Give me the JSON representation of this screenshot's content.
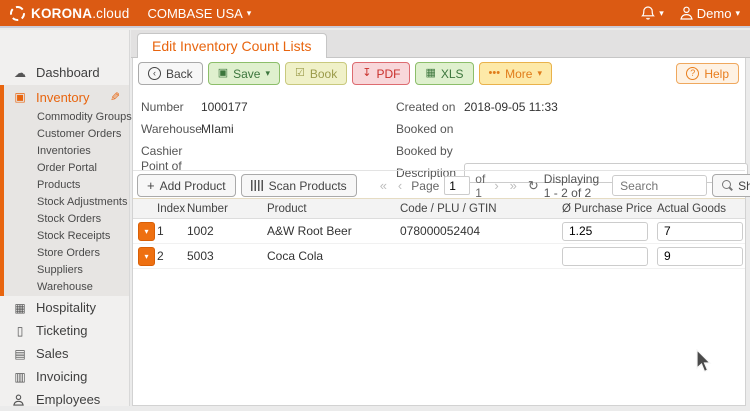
{
  "colors": {
    "brand_orange": "#E8650F",
    "topbar_bg": "#DB5A13",
    "save_green_bg": "#DFF0CE",
    "book_olive_bg": "#F0F1C8",
    "pdf_red_bg": "#F8D7DA",
    "more_yellow_bg": "#FDE9A8",
    "row_expander_orange": "#EE7011"
  },
  "icons": {
    "caret_down": "▾",
    "back": "‹",
    "save": "▣",
    "book": "☑",
    "pdf": "↧",
    "xls": "▦",
    "more": "•••",
    "help": "?",
    "add": "+",
    "refresh": "↻",
    "sort_up": "↑",
    "expander": "▾",
    "pencil": "✎",
    "first": "«",
    "prev": "‹",
    "next": "›",
    "last": "»",
    "dashboard": "☁",
    "inventory": "▣",
    "hospitality": "▦",
    "ticketing": "▯",
    "sales": "▤",
    "invoicing": "▥"
  },
  "topbar": {
    "brand_bold": "KORONA",
    "brand_suffix": ".cloud",
    "company": "COMBASE USA",
    "user_name": "Demo"
  },
  "tab_title": "Edit Inventory Count Lists",
  "toolbar": {
    "back": "Back",
    "save": "Save",
    "book": "Book",
    "pdf": "PDF",
    "xls": "XLS",
    "more": "More",
    "help": "Help"
  },
  "form": {
    "left": [
      {
        "label": "Number",
        "value": "1000177"
      },
      {
        "label": "Warehouse",
        "value": "MIami"
      },
      {
        "label": "Cashier",
        "value": ""
      },
      {
        "label": "Point of Sale",
        "value": ""
      }
    ],
    "right": [
      {
        "label": "Created on",
        "value": "2018-09-05 11:33"
      },
      {
        "label": "Booked on",
        "value": ""
      },
      {
        "label": "Booked by",
        "value": ""
      },
      {
        "label": "Description",
        "value": ""
      }
    ]
  },
  "listbar": {
    "add_product": "Add Product",
    "scan_products": "Scan Products",
    "page_label": "Page",
    "page_value": "1",
    "of_label": "of 1",
    "displaying": "Displaying 1 - 2 of 2",
    "search_placeholder": "Search",
    "show_nominal": "Show Nominal Goods"
  },
  "table": {
    "headers": {
      "index": "Index",
      "number": "Number",
      "product": "Product",
      "code": "Code / PLU / GTIN",
      "purchase": "Ø Purchase Price",
      "actual": "Actual Goods"
    },
    "rows": [
      {
        "index": "1",
        "number": "1002",
        "product": "A&W Root Beer",
        "code": "078000052404",
        "purchase_price": "1.25",
        "actual_goods": "7"
      },
      {
        "index": "2",
        "number": "5003",
        "product": "Coca Cola",
        "code": "",
        "purchase_price": "",
        "actual_goods": "9"
      }
    ]
  },
  "sidebar": {
    "dashboard": "Dashboard",
    "inventory": "Inventory",
    "inventory_sub": [
      "Commodity Groups",
      "Customer Orders",
      "Inventories",
      "Order Portal",
      "Products",
      "Stock Adjustments",
      "Stock Orders",
      "Stock Receipts",
      "Store Orders",
      "Suppliers",
      "Warehouse"
    ],
    "bottom": [
      "Hospitality",
      "Ticketing",
      "Sales",
      "Invoicing",
      "Employees"
    ]
  }
}
